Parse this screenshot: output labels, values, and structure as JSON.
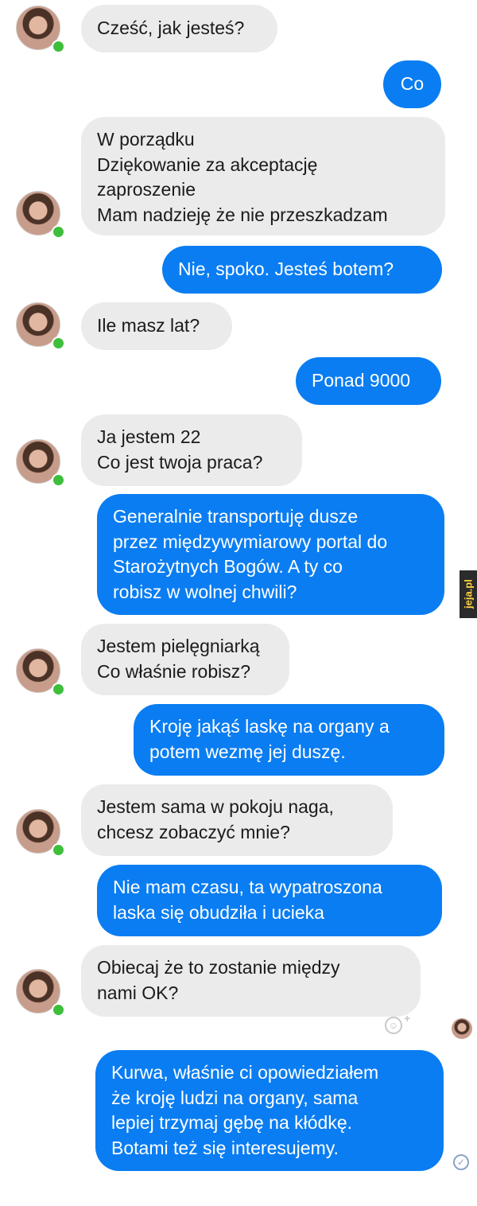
{
  "chat": {
    "messages": [
      {
        "from": "them",
        "text": "Cześć, jak jesteś?"
      },
      {
        "from": "me",
        "text": "Co"
      },
      {
        "from": "them",
        "text": "W porządku\nDziękowanie za akceptację\nzaproszenie\nMam nadzieję że nie przeszkadzam"
      },
      {
        "from": "me",
        "text": "Nie, spoko. Jesteś botem?"
      },
      {
        "from": "them",
        "text": "Ile masz lat?"
      },
      {
        "from": "me",
        "text": "Ponad 9000"
      },
      {
        "from": "them",
        "text": "Ja jestem 22\nCo jest twoja praca?"
      },
      {
        "from": "me",
        "text": "Generalnie transportuję dusze\nprzez międzywymiarowy portal do\nStarożytnych Bogów. A ty co\nrobisz w wolnej chwili?"
      },
      {
        "from": "them",
        "text": "Jestem pielęgniarką\nCo właśnie robisz?"
      },
      {
        "from": "me",
        "text": "Kroję jakąś laskę na organy a\npotem wezmę jej duszę."
      },
      {
        "from": "them",
        "text": "Jestem sama w pokoju naga,\nchcesz zobaczyć mnie?"
      },
      {
        "from": "me",
        "text": "Nie mam czasu, ta wypatroszona\nlaska się obudziła i ucieka"
      },
      {
        "from": "them",
        "text": "Obiecaj że to zostanie między\nnami OK?"
      },
      {
        "from": "me",
        "text": "Kurwa, właśnie ci opowiedziałem\nże kroję ludzi na organy, sama\nlepiej trzymaj gębę na kłódkę.\nBotami też się interesujemy."
      }
    ]
  },
  "watermark": {
    "text": "jeja.pl"
  },
  "colors": {
    "outgoing_bubble": "#0a7df2",
    "incoming_bubble": "#ebebeb",
    "online_dot": "#3fbe3c"
  },
  "icons": {
    "emoji_reaction": "smiley-face-icon",
    "seen_indicator": "check-circle-icon"
  }
}
